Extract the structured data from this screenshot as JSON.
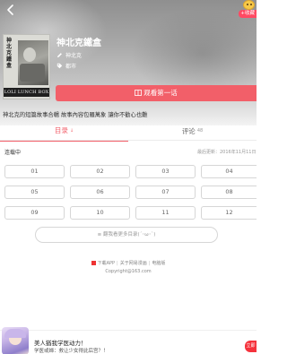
{
  "header": {
    "back_icon": "chevron-left-icon",
    "badge_label": "+收藏"
  },
  "book": {
    "cover_title": "神北克鐵盒",
    "cover_banner": "LOLI LUNCH BOX",
    "title": "神北克鐵盒",
    "author": "神北克",
    "tag": "都市",
    "read_button": "观看第一话",
    "description": "神北克的短篇故事合輯 故事內容包羅萬象 讓你不勸心也難"
  },
  "tabs": [
    {
      "label": "目录",
      "arrow": "↓"
    },
    {
      "label": "评论",
      "count": "48"
    }
  ],
  "catalog": {
    "status": "连载中",
    "updated": "最后更新：2016年11月11日",
    "chapters": [
      "01",
      "02",
      "03",
      "04",
      "05",
      "06",
      "07",
      "08",
      "09",
      "10",
      "11",
      "12"
    ],
    "more_button": "≡ 翻我看更多目录(´･ω･`)"
  },
  "footer": {
    "links": [
      "下載APP",
      "关于网易漫画",
      "电脑版"
    ],
    "copyright": "Copyright@163.com"
  },
  "ad": {
    "title": "美人猶我学医动力！",
    "subtitle": "学医或婦：救让少女得此后宫？！",
    "cta": "立即"
  },
  "colors": {
    "accent": "#f25f69",
    "ad_cta": "#f5323c"
  }
}
